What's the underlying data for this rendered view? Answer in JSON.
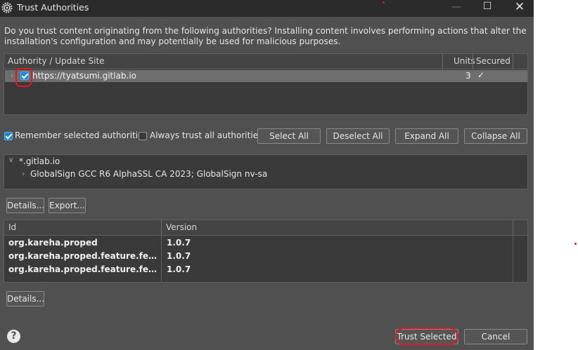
{
  "window": {
    "title": "Trust Authorities",
    "minimize_glyph": "—",
    "maximize_glyph": "☐",
    "close_glyph": "✕"
  },
  "description": "Do you trust content originating from the following authorities?  Installing content involves performing actions that alter the installation's configuration and may potentially be used for malicious purposes.",
  "authorities_table": {
    "columns": [
      "Authority / Update Site",
      "Units",
      "Secured"
    ],
    "rows": [
      {
        "checked": true,
        "site": "https://tyatsumi.gitlab.io",
        "units": "3",
        "secured": "✓"
      }
    ]
  },
  "options": {
    "remember_label": "Remember selected authorities",
    "remember_checked": true,
    "always_trust_label": "Always trust all authorities",
    "always_trust_checked": false
  },
  "buttons": {
    "select_all": "Select All",
    "deselect_all": "Deselect All",
    "expand_all": "Expand All",
    "collapse_all": "Collapse All",
    "details_1": "Details...",
    "export": "Export...",
    "details_2": "Details...",
    "trust_selected": "Trust Selected",
    "cancel": "Cancel"
  },
  "certificate_tree": {
    "root": "*.gitlab.io",
    "child": "GlobalSign GCC R6 AlphaSSL CA 2023; GlobalSign nv-sa"
  },
  "units_table": {
    "columns": [
      "Id",
      "Version"
    ],
    "rows": [
      {
        "id": "org.kareha.proped",
        "version": "1.0.7"
      },
      {
        "id": "org.kareha.proped.feature.feature....",
        "version": "1.0.7"
      },
      {
        "id": "org.kareha.proped.feature.feature.j...",
        "version": "1.0.7"
      }
    ]
  },
  "help_glyph": "?",
  "colors": {
    "dialog_bg": "#505050",
    "panel_bg": "#3a3a3a",
    "selected_row": "#6e6e6e",
    "checkbox_accent": "#1a86d6",
    "annotation_red": "#e0191e"
  }
}
